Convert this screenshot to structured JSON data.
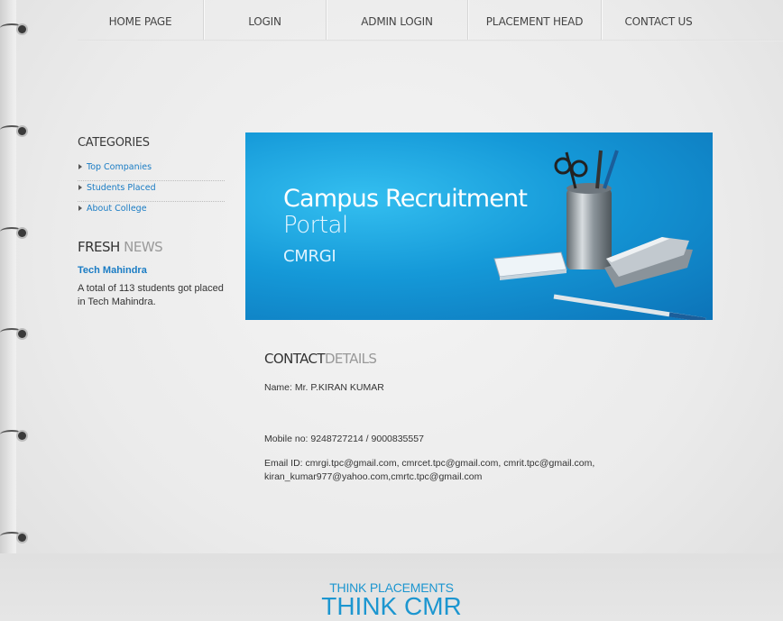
{
  "nav": {
    "items": [
      {
        "label": "HOME PAGE"
      },
      {
        "label": "LOGIN"
      },
      {
        "label": "ADMIN LOGIN"
      },
      {
        "label": "PLACEMENT HEAD"
      },
      {
        "label": "CONTACT US"
      }
    ]
  },
  "sidebar": {
    "categories_heading": "CATEGORIES",
    "categories": [
      {
        "label": "Top Companies"
      },
      {
        "label": "Students Placed"
      },
      {
        "label": "About College"
      }
    ],
    "news_heading_1": "FRESH",
    "news_heading_2": "NEWS",
    "news_title": "Tech Mahindra",
    "news_body": "A total of 113 students got placed in Tech Mahindra."
  },
  "banner": {
    "title": "Campus Recruitment",
    "subtitle": "Portal",
    "org": "CMRGI"
  },
  "contact": {
    "heading_1": "CONTACT",
    "heading_2": "DETAILS",
    "name": "Name: Mr. P.KIRAN KUMAR",
    "mobile": "Mobile no: 9248727214 / 9000835557",
    "email": "Email ID: cmrgi.tpc@gmail.com, cmrcet.tpc@gmail.com, cmrit.tpc@gmail.com, kiran_kumar977@yahoo.com,cmrtc.tpc@gmail.com"
  },
  "footer": {
    "line1": "THINK PLACEMENTS",
    "line2": "THINK CMR"
  },
  "colors": {
    "accent": "#1c96d0",
    "link": "#1a7cc4",
    "banner_blue": "#1599d8"
  },
  "icons": [
    "spiral-ring-icon",
    "bullet-arrow-icon"
  ]
}
